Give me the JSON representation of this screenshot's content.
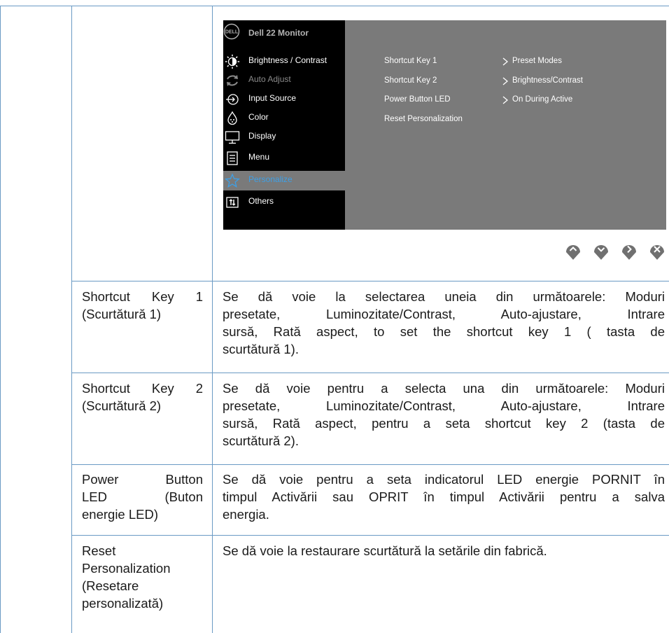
{
  "osd": {
    "title": "Dell 22 Monitor",
    "logo_text": "DELL",
    "menu": [
      {
        "label": "Brightness / Contrast",
        "icon": "brightness-icon"
      },
      {
        "label": "Auto Adjust",
        "icon": "auto-adjust-icon"
      },
      {
        "label": "Input Source",
        "icon": "input-source-icon"
      },
      {
        "label": "Color",
        "icon": "color-icon"
      },
      {
        "label": "Display",
        "icon": "display-icon"
      },
      {
        "label": "Menu",
        "icon": "menu-icon"
      },
      {
        "label": "Personalize",
        "icon": "star-icon"
      },
      {
        "label": "Others",
        "icon": "others-icon"
      }
    ],
    "submenu": [
      {
        "name": "Shortcut Key 1",
        "value": "Preset Modes"
      },
      {
        "name": "Shortcut Key 2",
        "value": "Brightness/Contrast"
      },
      {
        "name": "Power Button LED",
        "value": "On During Active"
      },
      {
        "name": "Reset Personalization",
        "value": ""
      }
    ],
    "colors": {
      "osd_bg": "#7a7a7a",
      "menu_bg": "#000000",
      "selected_text": "#3ea0e6"
    }
  },
  "nav_buttons": [
    "up-icon",
    "down-icon",
    "right-icon",
    "close-icon"
  ],
  "rows": [
    {
      "label_lines": [
        "Shortcut Key 1",
        "(Scurtătură 1)"
      ],
      "desc_lines": [
        "Se dă voie la selectarea uneia din următoarele: Moduri",
        "presetate, Luminozitate/Contrast, Auto-ajustare, Intrare",
        "sursă, Rată aspect, to set the shortcut key 1 ( tasta de",
        "scurtătură 1)."
      ]
    },
    {
      "label_lines": [
        "Shortcut Key 2",
        "(Scurtătură 2)"
      ],
      "desc_lines": [
        "Se dă voie pentru a selecta una din următoarele: Moduri",
        "presetate, Luminozitate/Contrast, Auto-ajustare, Intrare",
        "sursă, Rată aspect, pentru a seta shortcut key 2 (tasta de",
        "scurtătură 2)."
      ]
    },
    {
      "label_lines": [
        "Power Button",
        "LED (Buton",
        "energie LED)"
      ],
      "desc_lines": [
        "Se dă voie pentru a seta indicatorul LED energie PORNIT în",
        "timpul Activării sau OPRIT în timpul Activării pentru a salva",
        "energia."
      ]
    },
    {
      "label_lines": [
        "Reset",
        "Personalization",
        "(Resetare",
        "personalizată)"
      ],
      "desc_lines": [
        "Se dă voie la restaurare scurtătură la setările din fabrică."
      ]
    }
  ]
}
